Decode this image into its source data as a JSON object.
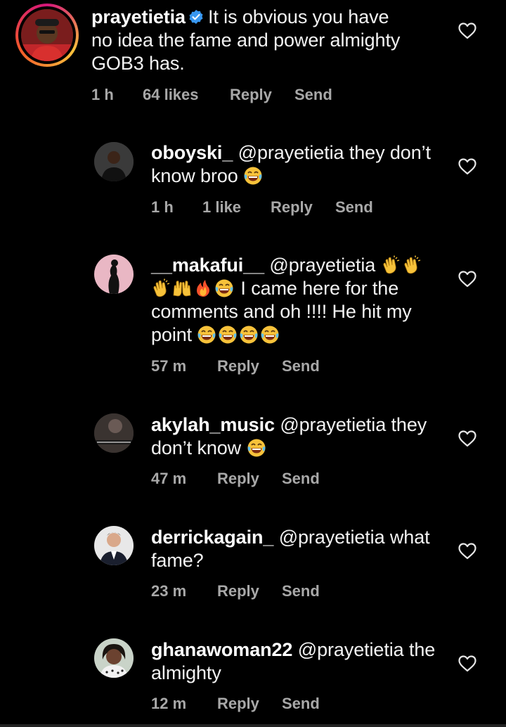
{
  "comments": [
    {
      "username": "prayetietia",
      "verified": true,
      "text_lines": [
        "It is obvious you have",
        "no idea the fame and power almighty",
        "GOB3 has."
      ],
      "time": "1 h",
      "likes": "64 likes",
      "reply": "Reply",
      "send": "Send"
    },
    {
      "username": "oboyski_",
      "mention": "@prayetietia",
      "text_a": "they don’t",
      "text_b": "know broo",
      "time": "1 h",
      "likes": "1 like",
      "reply": "Reply",
      "send": "Send"
    },
    {
      "username": "__makafui__",
      "mention": "@prayetietia",
      "text_a": "I came here for the",
      "text_b": "comments and oh !!!! He hit my",
      "text_c": "point",
      "time": "57 m",
      "reply": "Reply",
      "send": "Send"
    },
    {
      "username": "akylah_music",
      "mention": "@prayetietia",
      "text_a": "they",
      "text_b": "don’t know",
      "time": "47 m",
      "reply": "Reply",
      "send": "Send"
    },
    {
      "username": "derrickagain_",
      "mention": "@prayetietia",
      "text_a": "what",
      "text_b": "fame?",
      "time": "23 m",
      "reply": "Reply",
      "send": "Send"
    },
    {
      "username": "ghanawoman22",
      "mention": "@prayetietia",
      "text_a": "the",
      "text_b": "almighty",
      "time": "12 m",
      "reply": "Reply",
      "send": "Send"
    }
  ],
  "icons": {
    "heart": "heart-outline-icon",
    "verified": "verified-badge-icon",
    "laugh": "tears-of-joy-emoji",
    "clap": "clapping-hands-emoji",
    "raise": "raising-hands-emoji",
    "fire": "fire-emoji"
  },
  "colors": {
    "background": "#000000",
    "text": "#f2f2f2",
    "meta": "#a8a8a8",
    "verified": "#3897f0",
    "story_ring_start": "#f9c23c",
    "story_ring_end": "#d4157b"
  }
}
